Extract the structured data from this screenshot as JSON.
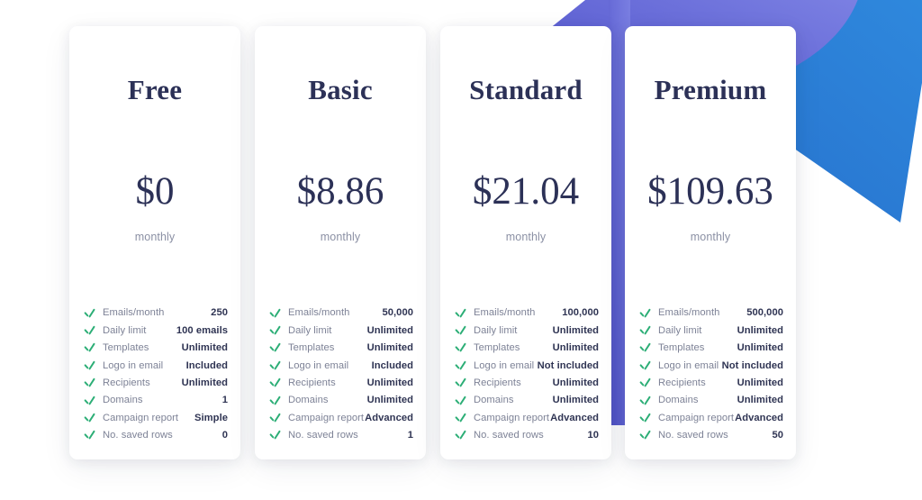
{
  "background": {
    "shape_purple_color": "#5b5fd4",
    "shape_purple_light_color": "#7b80e0",
    "shape_blue_color": "#2f7fd6",
    "shape_blue_dark_color": "#2a62c9",
    "page_background": "#ffffff"
  },
  "theme": {
    "heading_color": "#2c3157",
    "price_color": "#2c3157",
    "period_color": "#8b90a4",
    "feature_label_color": "#7d8296",
    "feature_value_color": "#2f3453",
    "check_color": "#2cae76",
    "card_background": "#ffffff"
  },
  "feature_names": [
    "Emails/month",
    "Daily limit",
    "Templates",
    "Logo in email",
    "Recipients",
    "Domains",
    "Campaign report",
    "No. saved rows"
  ],
  "plans": [
    {
      "name": "Free",
      "price": "$0",
      "period": "monthly",
      "features": [
        {
          "label": "Emails/month",
          "value": "250",
          "icon": "check-icon"
        },
        {
          "label": "Daily limit",
          "value": "100 emails",
          "icon": "check-icon"
        },
        {
          "label": "Templates",
          "value": "Unlimited",
          "icon": "check-icon"
        },
        {
          "label": "Logo in email",
          "value": "Included",
          "icon": "check-icon"
        },
        {
          "label": "Recipients",
          "value": "Unlimited",
          "icon": "check-icon"
        },
        {
          "label": "Domains",
          "value": "1",
          "icon": "check-icon"
        },
        {
          "label": "Campaign report",
          "value": "Simple",
          "icon": "check-icon"
        },
        {
          "label": "No. saved rows",
          "value": "0",
          "icon": "check-icon"
        }
      ]
    },
    {
      "name": "Basic",
      "price": "$8.86",
      "period": "monthly",
      "features": [
        {
          "label": "Emails/month",
          "value": "50,000",
          "icon": "check-icon"
        },
        {
          "label": "Daily limit",
          "value": "Unlimited",
          "icon": "check-icon"
        },
        {
          "label": "Templates",
          "value": "Unlimited",
          "icon": "check-icon"
        },
        {
          "label": "Logo in email",
          "value": "Included",
          "icon": "check-icon"
        },
        {
          "label": "Recipients",
          "value": "Unlimited",
          "icon": "check-icon"
        },
        {
          "label": "Domains",
          "value": "Unlimited",
          "icon": "check-icon"
        },
        {
          "label": "Campaign report",
          "value": "Advanced",
          "icon": "check-icon"
        },
        {
          "label": "No. saved rows",
          "value": "1",
          "icon": "check-icon"
        }
      ]
    },
    {
      "name": "Standard",
      "price": "$21.04",
      "period": "monthly",
      "features": [
        {
          "label": "Emails/month",
          "value": "100,000",
          "icon": "check-icon"
        },
        {
          "label": "Daily limit",
          "value": "Unlimited",
          "icon": "check-icon"
        },
        {
          "label": "Templates",
          "value": "Unlimited",
          "icon": "check-icon"
        },
        {
          "label": "Logo in email",
          "value": "Not included",
          "icon": "check-icon"
        },
        {
          "label": "Recipients",
          "value": "Unlimited",
          "icon": "check-icon"
        },
        {
          "label": "Domains",
          "value": "Unlimited",
          "icon": "check-icon"
        },
        {
          "label": "Campaign report",
          "value": "Advanced",
          "icon": "check-icon"
        },
        {
          "label": "No. saved rows",
          "value": "10",
          "icon": "check-icon"
        }
      ]
    },
    {
      "name": "Premium",
      "price": "$109.63",
      "period": "monthly",
      "features": [
        {
          "label": "Emails/month",
          "value": "500,000",
          "icon": "check-icon"
        },
        {
          "label": "Daily limit",
          "value": "Unlimited",
          "icon": "check-icon"
        },
        {
          "label": "Templates",
          "value": "Unlimited",
          "icon": "check-icon"
        },
        {
          "label": "Logo in email",
          "value": "Not included",
          "icon": "check-icon"
        },
        {
          "label": "Recipients",
          "value": "Unlimited",
          "icon": "check-icon"
        },
        {
          "label": "Domains",
          "value": "Unlimited",
          "icon": "check-icon"
        },
        {
          "label": "Campaign report",
          "value": "Advanced",
          "icon": "check-icon"
        },
        {
          "label": "No. saved rows",
          "value": "50",
          "icon": "check-icon"
        }
      ]
    }
  ]
}
